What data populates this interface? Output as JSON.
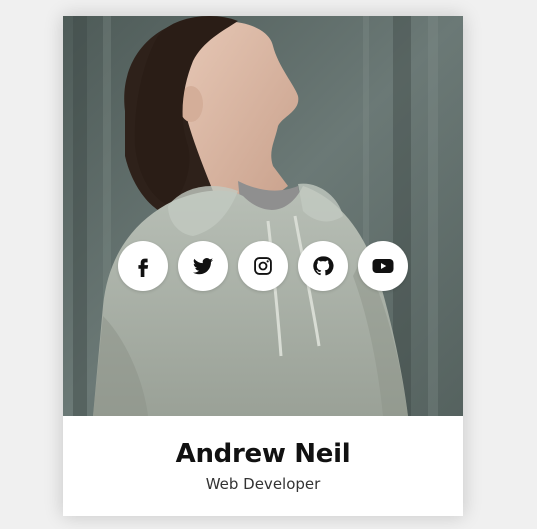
{
  "profile": {
    "name": "Andrew Neil",
    "role": "Web Developer"
  },
  "social": [
    {
      "icon": "facebook-icon"
    },
    {
      "icon": "twitter-icon"
    },
    {
      "icon": "instagram-icon"
    },
    {
      "icon": "github-icon"
    },
    {
      "icon": "youtube-icon"
    }
  ],
  "colors": {
    "card_background": "#ffffff",
    "page_background": "#f0f0f0",
    "icon_color": "#111111",
    "button_background": "#ffffff"
  }
}
